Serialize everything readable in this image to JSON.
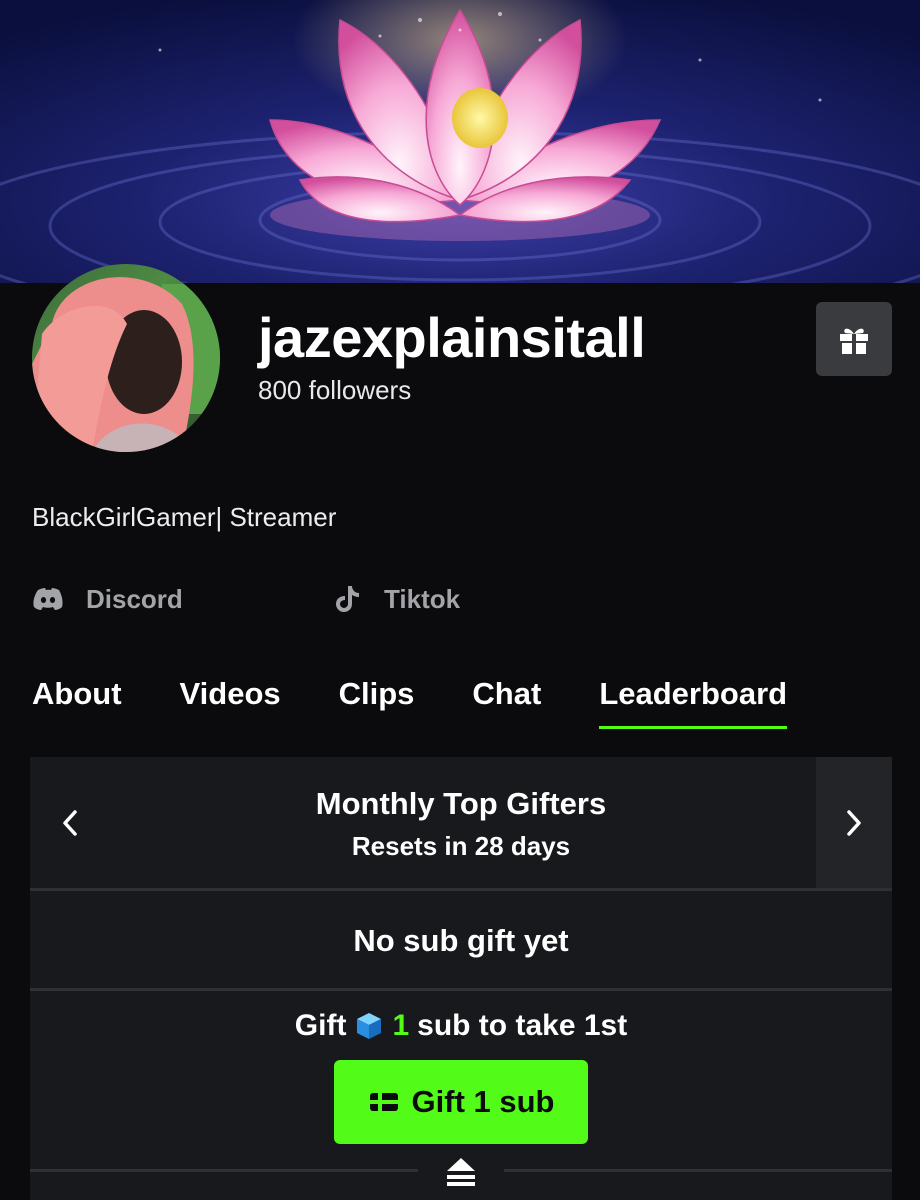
{
  "channel": {
    "username": "jazexplainsitall",
    "followers": "800 followers",
    "bio": "BlackGirlGamer| Streamer"
  },
  "socials": [
    {
      "label": "Discord",
      "icon": "discord-icon"
    },
    {
      "label": "Tiktok",
      "icon": "tiktok-icon"
    }
  ],
  "tabs": [
    {
      "label": "About",
      "active": false
    },
    {
      "label": "Videos",
      "active": false
    },
    {
      "label": "Clips",
      "active": false
    },
    {
      "label": "Chat",
      "active": false
    },
    {
      "label": "Leaderboard",
      "active": true
    }
  ],
  "leaderboard": {
    "title": "Monthly Top Gifters",
    "subtitle": "Resets in 28 days",
    "empty_text": "No sub gift yet",
    "cta_prefix": "Gift",
    "cta_count": "1",
    "cta_suffix": "sub to take 1st",
    "button_label": "Gift 1 sub"
  },
  "colors": {
    "accent": "#53fc18",
    "background": "#0b0b0d",
    "panel": "#18191c"
  }
}
